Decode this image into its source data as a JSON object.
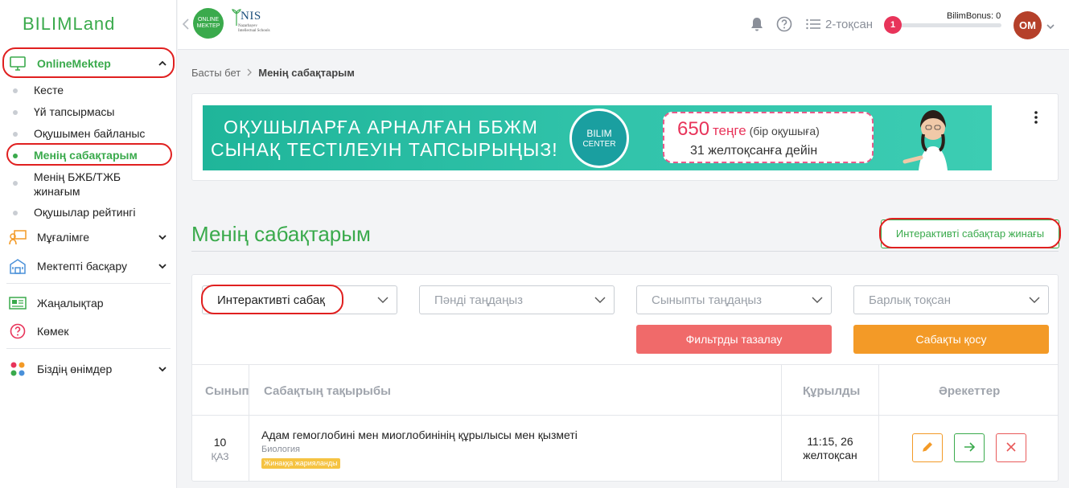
{
  "app": {
    "logo": "BILIMLand"
  },
  "header": {
    "onlinemektep_logo": "ONLINE MEKTEP",
    "nis_logo": "NIS",
    "nis_sub": "Nazarbayev Intellectual Schools",
    "quarter": "2-тоқсан",
    "notifications_count": "1",
    "bilimbonus_label": "BilimBonus: 0",
    "bilimbonus_progress": 0,
    "avatar_initials": "OM",
    "colors": {
      "accent": "#3aaa4c",
      "badge": "#e8345a",
      "avatar": "#b5402a"
    }
  },
  "sidebar": {
    "sections": [
      {
        "label": "OnlineMektep",
        "icon": "monitor-icon",
        "expanded": true
      },
      {
        "label": "Мұғалімге",
        "icon": "teacher-icon"
      },
      {
        "label": "Мектепті басқару",
        "icon": "school-icon"
      },
      {
        "label": "Жаңалықтар",
        "icon": "news-icon"
      },
      {
        "label": "Көмек",
        "icon": "help-icon"
      },
      {
        "label": "Біздің өнімдер",
        "icon": "products-icon"
      }
    ],
    "sub_items": [
      {
        "label": "Кесте"
      },
      {
        "label": "Үй тапсырмасы"
      },
      {
        "label": "Оқушымен байланыс"
      },
      {
        "label": "Менің сабақтарым",
        "active": true
      },
      {
        "label": "Менің БЖБ/ТЖБ жинағым"
      },
      {
        "label": "Оқушылар рейтингі"
      }
    ]
  },
  "breadcrumb": {
    "home": "Басты бет",
    "current": "Менің сабақтарым"
  },
  "banner": {
    "line1": "ОҚУШЫЛАРҒА АРНАЛҒАН ББЖМ",
    "line2": "СЫНАҚ ТЕСТІЛЕУІН ТАПСЫРЫҢЫЗ!",
    "brand_line1": "BILIM",
    "brand_line2": "CENTER",
    "price_number": "650",
    "price_unit": "теңге",
    "price_note": "(бір оқушыға)",
    "deadline": "31 желтоқсанға дейін"
  },
  "main": {
    "title": "Менің сабақтарым",
    "interactive_collection_button": "Интерактивті сабақтар жинағы"
  },
  "filters": {
    "type_select": "Интерактивті сабақ",
    "subject_placeholder": "Пәнді таңдаңыз",
    "class_placeholder": "Сыныпты таңдаңыз",
    "quarter_placeholder": "Барлық тоқсан",
    "clear_button": "Фильтрды тазалау",
    "add_button": "Сабақты қосу"
  },
  "table": {
    "headers": {
      "grade": "Сынып",
      "topic": "Сабақтың тақырыбы",
      "created": "Құрылды",
      "actions": "Әрекеттер"
    },
    "rows": [
      {
        "grade": "10",
        "lang": "ҚАЗ",
        "title": "Адам гемоглобині мен миоглобинінің құрылысы мен қызметі",
        "subject": "Биология",
        "tag": "Жинаққа жарияланды",
        "created_time": "11:15, 26",
        "created_date": "желтоқсан"
      }
    ]
  }
}
